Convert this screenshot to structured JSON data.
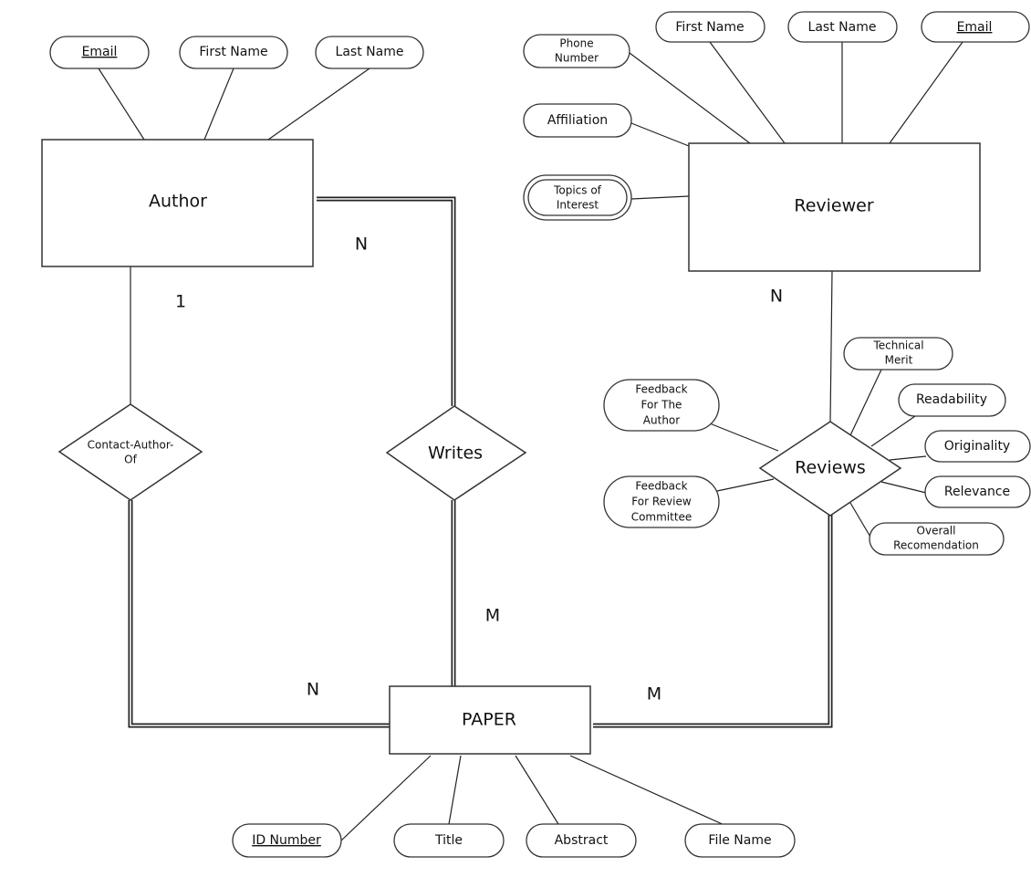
{
  "entities": {
    "author": "Author",
    "reviewer": "Reviewer",
    "paper": "PAPER"
  },
  "relationships": {
    "contact_author_of_1": "Contact-Author-",
    "contact_author_of_2": "Of",
    "writes": "Writes",
    "reviews": "Reviews"
  },
  "author_attributes": {
    "email": "Email",
    "first_name": "First Name",
    "last_name": "Last Name"
  },
  "reviewer_attributes": {
    "phone_1": "Phone",
    "phone_2": "Number",
    "first_name": "First Name",
    "last_name": "Last Name",
    "email": "Email",
    "affiliation": "Affiliation",
    "topics_1": "Topics of",
    "topics_2": "Interest"
  },
  "reviews_attributes": {
    "fta_1": "Feedback",
    "fta_2": "For The",
    "fta_3": "Author",
    "frc_1": "Feedback",
    "frc_2": "For Review",
    "frc_3": "Committee",
    "tm_1": "Technical",
    "tm_2": "Merit",
    "readability": "Readability",
    "originality": "Originality",
    "relevance": "Relevance",
    "or_1": "Overall",
    "or_2": "Recomendation"
  },
  "paper_attributes": {
    "id_number": "ID Number",
    "title": "Title",
    "abstract": "Abstract",
    "file_name": "File Name"
  },
  "cardinalities": {
    "writes_author": "N",
    "contact_author": "1",
    "reviews_reviewer": "N",
    "writes_paper": "M",
    "contact_paper": "N",
    "reviews_paper": "M"
  }
}
